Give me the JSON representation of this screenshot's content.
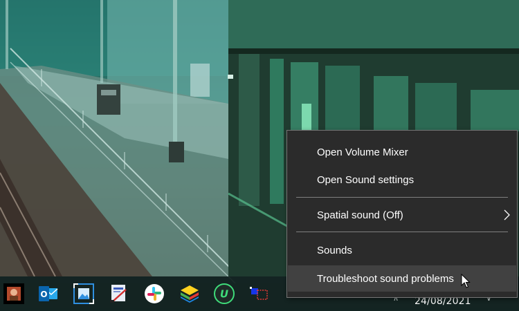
{
  "context_menu": {
    "items": [
      {
        "label": "Open Volume Mixer"
      },
      {
        "label": "Open Sound settings"
      },
      {
        "label": "Spatial sound (Off)"
      },
      {
        "label": "Sounds"
      },
      {
        "label": "Troubleshoot sound problems"
      }
    ],
    "highlighted_item": "Troubleshoot sound problems",
    "submenu_icon": "chevron-right-icon"
  },
  "taskbar": {
    "apps": [
      {
        "icon": "photo-thumbnail-icon"
      },
      {
        "icon": "outlook-icon"
      },
      {
        "icon": "image-resizer-icon"
      },
      {
        "icon": "drawing-app-icon"
      },
      {
        "icon": "slack-icon"
      },
      {
        "icon": "bluestacks-icon"
      },
      {
        "icon": "u-app-icon"
      },
      {
        "icon": "screen-capture-icon"
      }
    ],
    "tray": {
      "date": "24/08/2021",
      "overflow_icon": "chevron-up-icon",
      "notification_icon": "notification-icon"
    }
  },
  "colors": {
    "menu_background": "#2b2b2b",
    "menu_border": "#767676",
    "menu_highlight": "#414141",
    "taskbar_background": "#122221"
  }
}
